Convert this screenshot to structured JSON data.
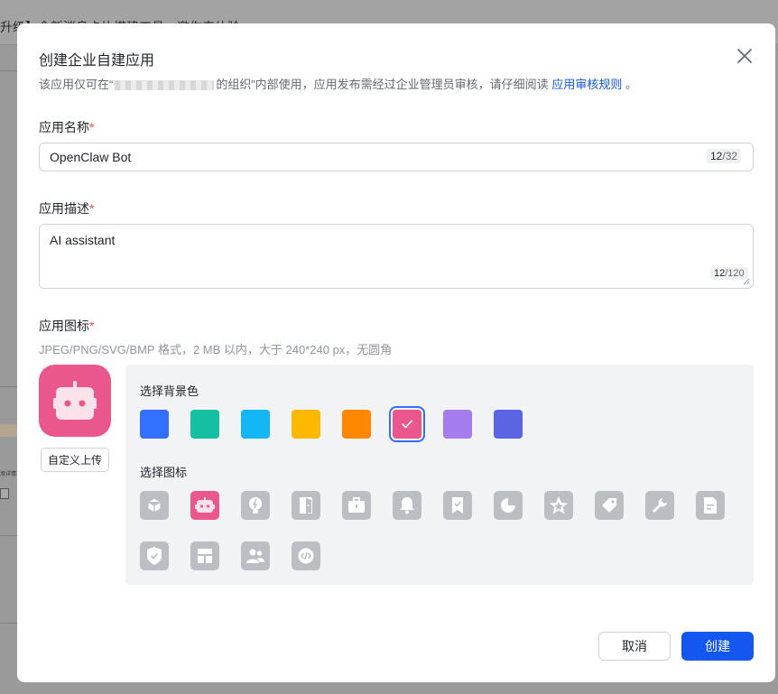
{
  "background": {
    "topbar_text": "升级】全新消息卡片搭建工具，邀你来体验",
    "tiny_text": "添详情"
  },
  "dialog": {
    "title": "创建企业自建应用",
    "subtitle_prefix": "该应用仅可在“",
    "subtitle_org_masked": "█████████",
    "subtitle_middle": "的组织”内部使用，应用发布需经过企业管理员审核，请仔细阅读",
    "subtitle_link": "应用审核规则",
    "subtitle_suffix": "。"
  },
  "name_field": {
    "label": "应用名称",
    "required_mark": "*",
    "value": "OpenClaw Bot",
    "count": "12",
    "max": "/32"
  },
  "desc_field": {
    "label": "应用描述",
    "required_mark": "*",
    "value": "AI assistant",
    "count": "12",
    "max": "/120"
  },
  "icon_field": {
    "label": "应用图标",
    "required_mark": "*",
    "hint": "JPEG/PNG/SVG/BMP 格式，2 MB 以内，大于 240*240 px，无圆角",
    "upload_label": "自定义上传",
    "bg_color_label": "选择背景色",
    "icon_label": "选择图标",
    "bg_colors": [
      "#3370ff",
      "#14c0a0",
      "#14b7f5",
      "#ffb800",
      "#ff8800",
      "#e9578d",
      "#a57bf0",
      "#5b64e3"
    ],
    "selected_bg_color": "#e9578d",
    "icons": [
      "cube-icon",
      "robot-icon",
      "lightbulb-icon",
      "door-icon",
      "briefcase-icon",
      "bell-icon",
      "bookmark-check-icon",
      "pie-chart-icon",
      "star-icon",
      "tag-icon",
      "wrench-icon",
      "document-icon",
      "shield-check-icon",
      "layout-icon",
      "users-icon",
      "code-icon"
    ],
    "selected_icon": "robot-icon"
  },
  "footer": {
    "cancel_label": "取消",
    "create_label": "创建"
  }
}
